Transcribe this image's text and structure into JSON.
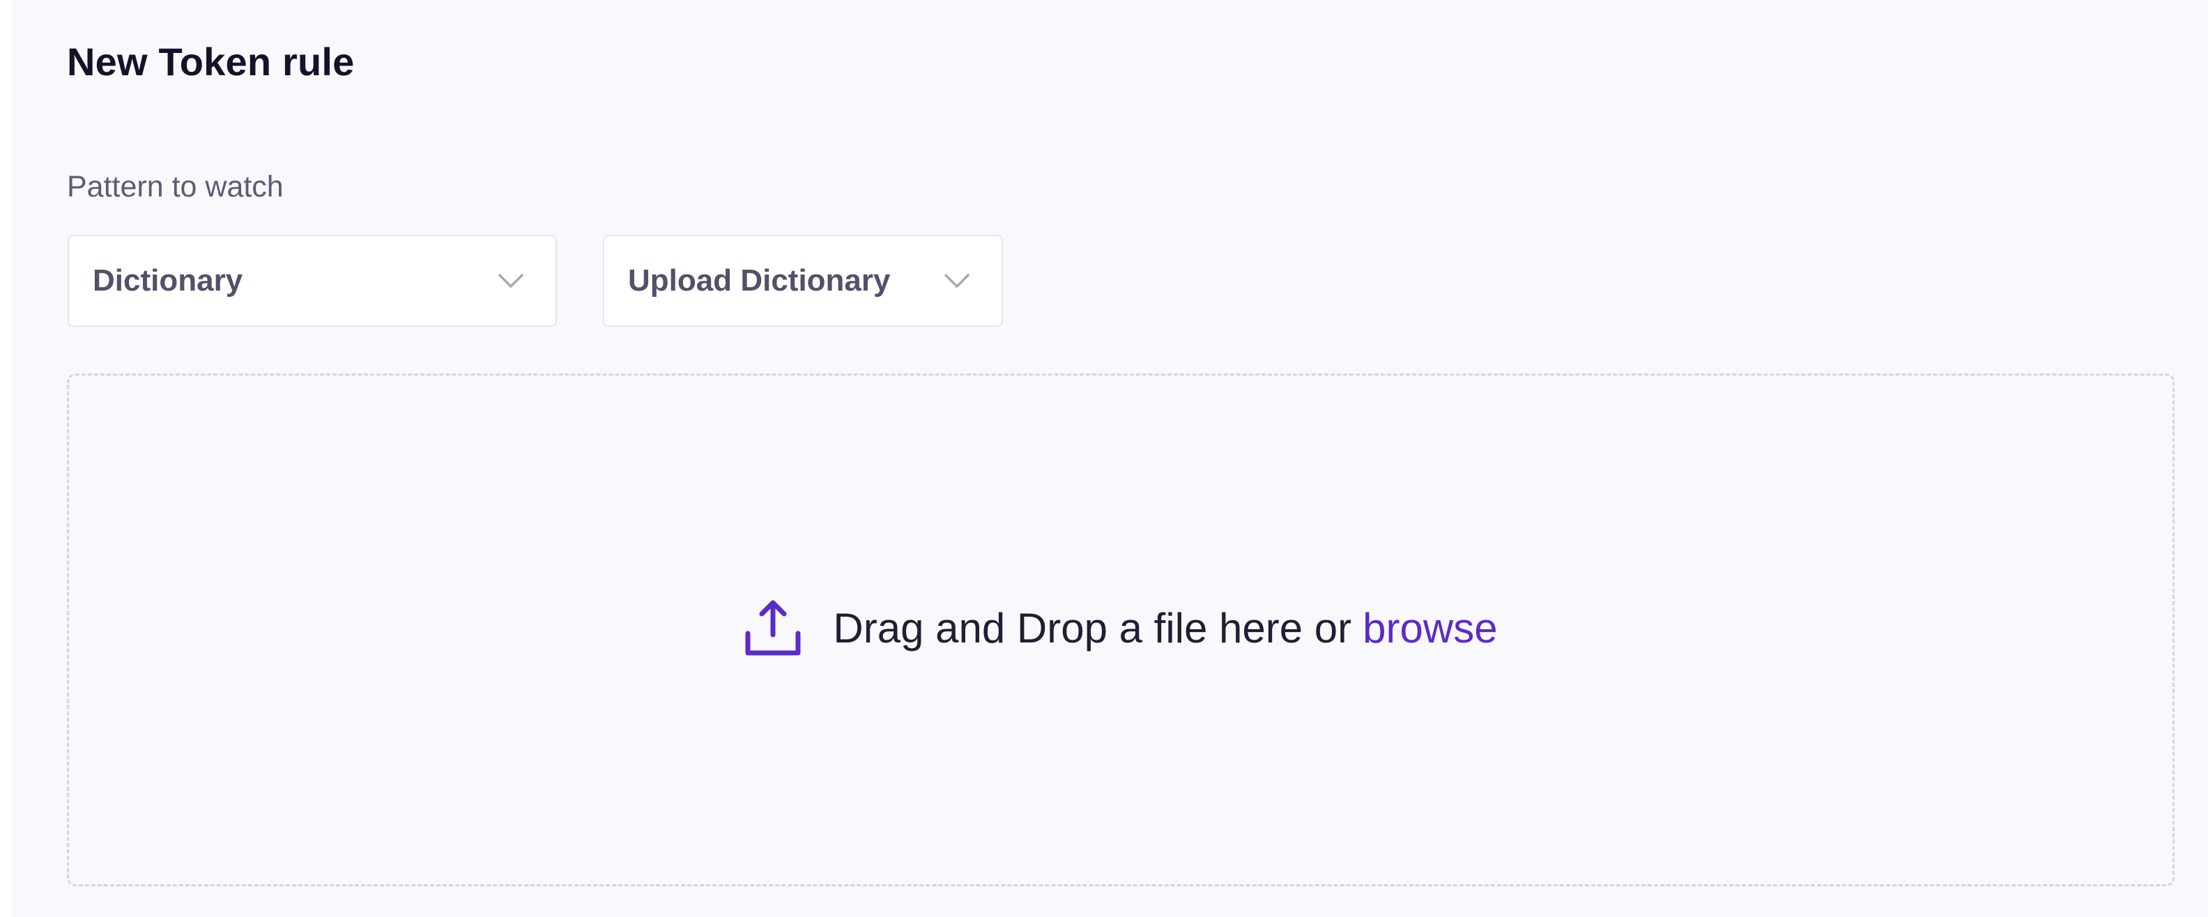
{
  "form": {
    "title": "New Token rule",
    "pattern_label": "Pattern to watch"
  },
  "selects": {
    "pattern_type": {
      "value": "Dictionary",
      "icon": "chevron-down-icon"
    },
    "dictionary_source": {
      "value": "Upload Dictionary",
      "icon": "chevron-down-icon"
    }
  },
  "dropzone": {
    "icon": "upload-icon",
    "text": "Drag and Drop a file here or",
    "browse_label": "browse"
  },
  "colors": {
    "accent": "#5b2bc9",
    "panel_background": "#f9f8fd",
    "title_text": "#14132a",
    "muted_text": "#5d5c72",
    "select_text": "#52516a",
    "border": "#e6e5ee",
    "dropzone_border": "#d6d5de"
  }
}
